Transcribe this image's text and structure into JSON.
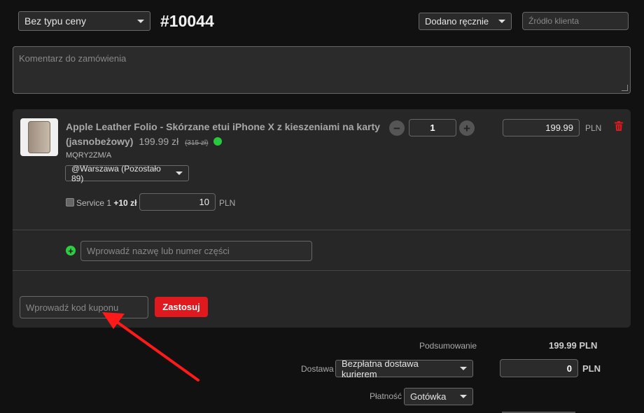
{
  "header": {
    "price_type": "Bez typu ceny",
    "order_number": "#10044",
    "added_mode": "Dodano ręcznie",
    "client_source_placeholder": "Źródło klienta"
  },
  "comment": {
    "placeholder": "Komentarz do zamówienia"
  },
  "product": {
    "title": "Apple Leather Folio - Skórzane etui iPhone X z kieszeniami na karty (jasnobeżowy)",
    "price": "199.99 zł",
    "old_price": "(315 zł)",
    "sku": "MQRY2ZM/A",
    "warehouse": "@Warszawa (Pozostało 89)",
    "quantity": "1",
    "unit_price": "199.99",
    "currency": "PLN",
    "stock_status_color": "#27c93f"
  },
  "service": {
    "label": "Service 1",
    "extra": "+10 zł",
    "price": "10",
    "currency": "PLN"
  },
  "add_part": {
    "placeholder": "Wprowadź nazwę lub numer części"
  },
  "coupon": {
    "placeholder": "Wprowadź kod kuponu",
    "apply_label": "Zastosuj"
  },
  "summary": {
    "label": "Podsumowanie",
    "value": "199.99 PLN",
    "shipping_label": "Dostawa",
    "shipping_method": "Bezpłatna dostawa kurierem",
    "shipping_cost": "0",
    "shipping_currency": "PLN",
    "payment_label": "Płatność",
    "payment_method": "Gotówka"
  },
  "colors": {
    "accent_red": "#e0191e",
    "add_green": "#2ecc40"
  },
  "icons": {
    "trash": "trash-icon",
    "add": "plus-circle-icon",
    "caret": "chevron-down-icon"
  }
}
